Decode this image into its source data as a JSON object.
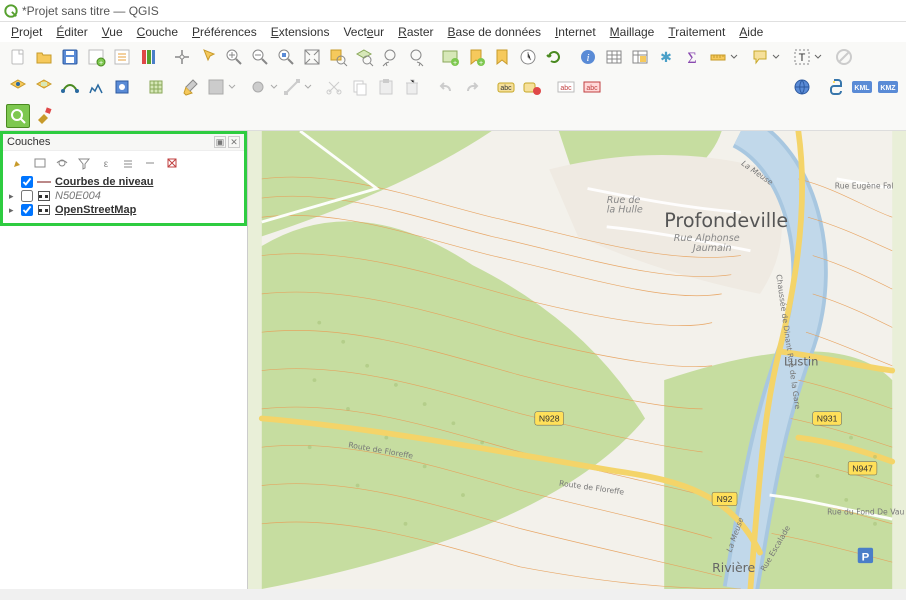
{
  "window": {
    "title": "*Projet sans titre — QGIS"
  },
  "menu": {
    "items": [
      "Projet",
      "Éditer",
      "Vue",
      "Couche",
      "Préférences",
      "Extensions",
      "Vecteur",
      "Raster",
      "Base de données",
      "Internet",
      "Maillage",
      "Traitement",
      "Aide"
    ]
  },
  "layers_panel": {
    "title": "Couches",
    "layers": [
      {
        "checked": true,
        "expandable": false,
        "name": "Courbes de niveau",
        "style": "bold",
        "swatch": "line"
      },
      {
        "checked": false,
        "expandable": true,
        "name": "N50E004",
        "style": "italic",
        "swatch": "checker"
      },
      {
        "checked": true,
        "expandable": true,
        "name": "OpenStreetMap",
        "style": "bold",
        "swatch": "checker"
      }
    ]
  },
  "map": {
    "places": {
      "profondeville": "Profondeville",
      "lustin": "Lustin",
      "riviere": "Rivière"
    },
    "streets": {
      "hulle": "Rue de la Hulle",
      "alphonse": "Rue Alphonse Jaumain",
      "eugene": "Rue Eugène Fal",
      "gare": "Chaussée de Dinant Rue de la Gare",
      "floreffe1": "Route de Floreffe",
      "floreffe2": "Route de Floreffe",
      "fonddevau": "Rue du Fond De Vau",
      "escalade": "Rue Escalade",
      "meuse": "La Meuse",
      "meuse2": "La Meuse"
    },
    "shields": {
      "n928": "N928",
      "n92": "N92",
      "n931": "N931",
      "n947": "N947"
    },
    "parking": "P"
  },
  "toolbar_icons": {
    "row1": [
      "new-project",
      "open-project",
      "save-project",
      "save-as",
      "print-layout",
      "style-manager",
      "sep",
      "pan",
      "pan-selection",
      "zoom-in",
      "zoom-out",
      "zoom-native",
      "zoom-full",
      "zoom-selection",
      "zoom-layer",
      "zoom-last",
      "zoom-next",
      "sep",
      "new-map",
      "new-bookmark",
      "bookmark",
      "temporal",
      "refresh",
      "sep",
      "identify",
      "open-table",
      "field-calc",
      "statistics",
      "sigma",
      "measure",
      "sep",
      "tip",
      "sep",
      "label",
      "sep",
      "no-action"
    ],
    "row2": [
      "add-vector",
      "add-raster",
      "add-virtual",
      "add-wms",
      "add-csv",
      "sep",
      "add-spatialite",
      "sep",
      "edit-toggle",
      "save-edits",
      "sep",
      "add-feature",
      "vertex-tool",
      "sep",
      "cut",
      "copy",
      "paste",
      "delete",
      "sep",
      "undo",
      "redo",
      "sep",
      "abc-annotation",
      "labeling",
      "sep",
      "abc-box",
      "abc-diag",
      "sep",
      "sep",
      "sep",
      "sep",
      "sep",
      "sep",
      "sep",
      "globe",
      "sep",
      "python",
      "kml",
      "kmz"
    ],
    "row3": [
      "quick-search",
      "processing-toolbox"
    ]
  }
}
